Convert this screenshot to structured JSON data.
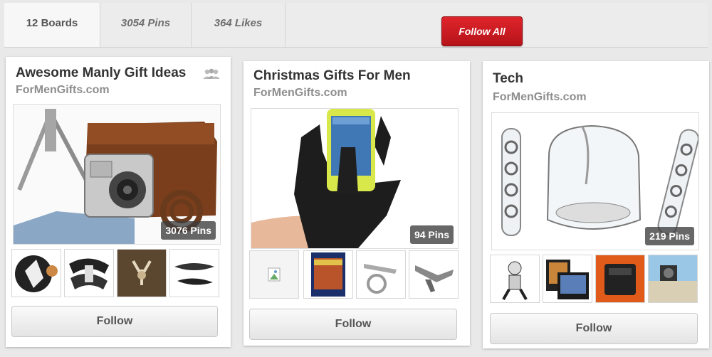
{
  "stats": {
    "boards": "12 Boards",
    "pins": "3054 Pins",
    "likes": "364 Likes",
    "follow_all": "Follow All"
  },
  "boards": [
    {
      "title": "Awesome Manly Gift Ideas",
      "source": "ForMenGifts.com",
      "pins": "3076 Pins",
      "follow": "Follow"
    },
    {
      "title": "Christmas Gifts For Men",
      "source": "ForMenGifts.com",
      "pins": "94 Pins",
      "follow": "Follow"
    },
    {
      "title": "Tech",
      "source": "ForMenGifts.com",
      "pins": "219 Pins",
      "follow": "Follow"
    }
  ],
  "colors": {
    "accent_red": "#cc1d24",
    "background": "#e9e9e9",
    "card": "#ffffff"
  }
}
